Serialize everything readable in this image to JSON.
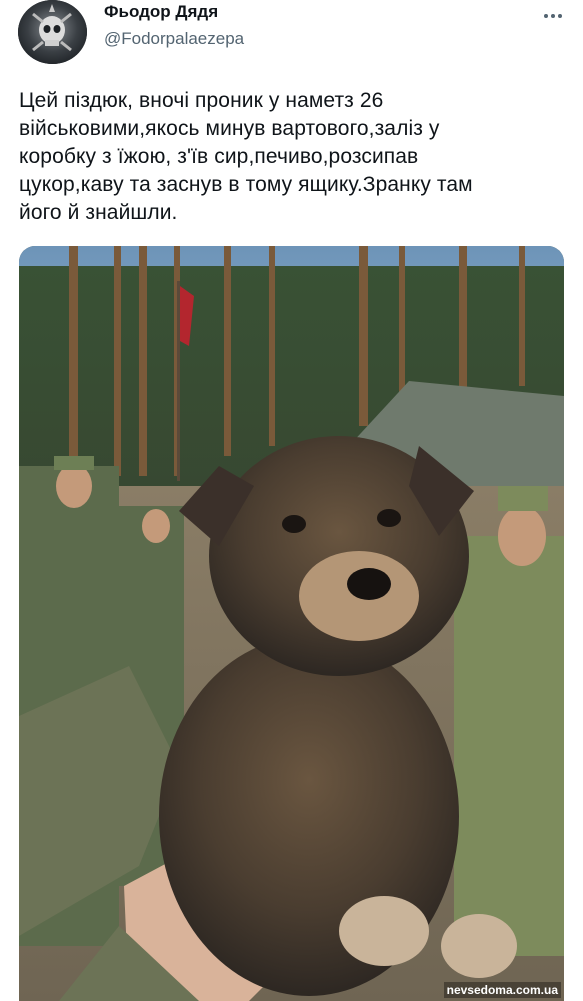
{
  "user": {
    "display_name": "Фьодор Дядя",
    "handle": "@Fodorpalaezepa",
    "avatar_icon": "skull-avatar-icon"
  },
  "tweet": {
    "text": "Цей піздюк, вночі проник у наметз 26\nвійськовими,якось минув вартового,заліз у\nкоробку з їжою, з'їв сир,печиво,розсипав\nцукор,каву та заснув в тому ящику.Зранку там\nйого й знайшли."
  },
  "photo": {
    "description_icon": "puppy-photo",
    "watermark": "nevsedoma.com.ua"
  },
  "colors": {
    "text": "#0f1419",
    "secondary": "#536471"
  }
}
